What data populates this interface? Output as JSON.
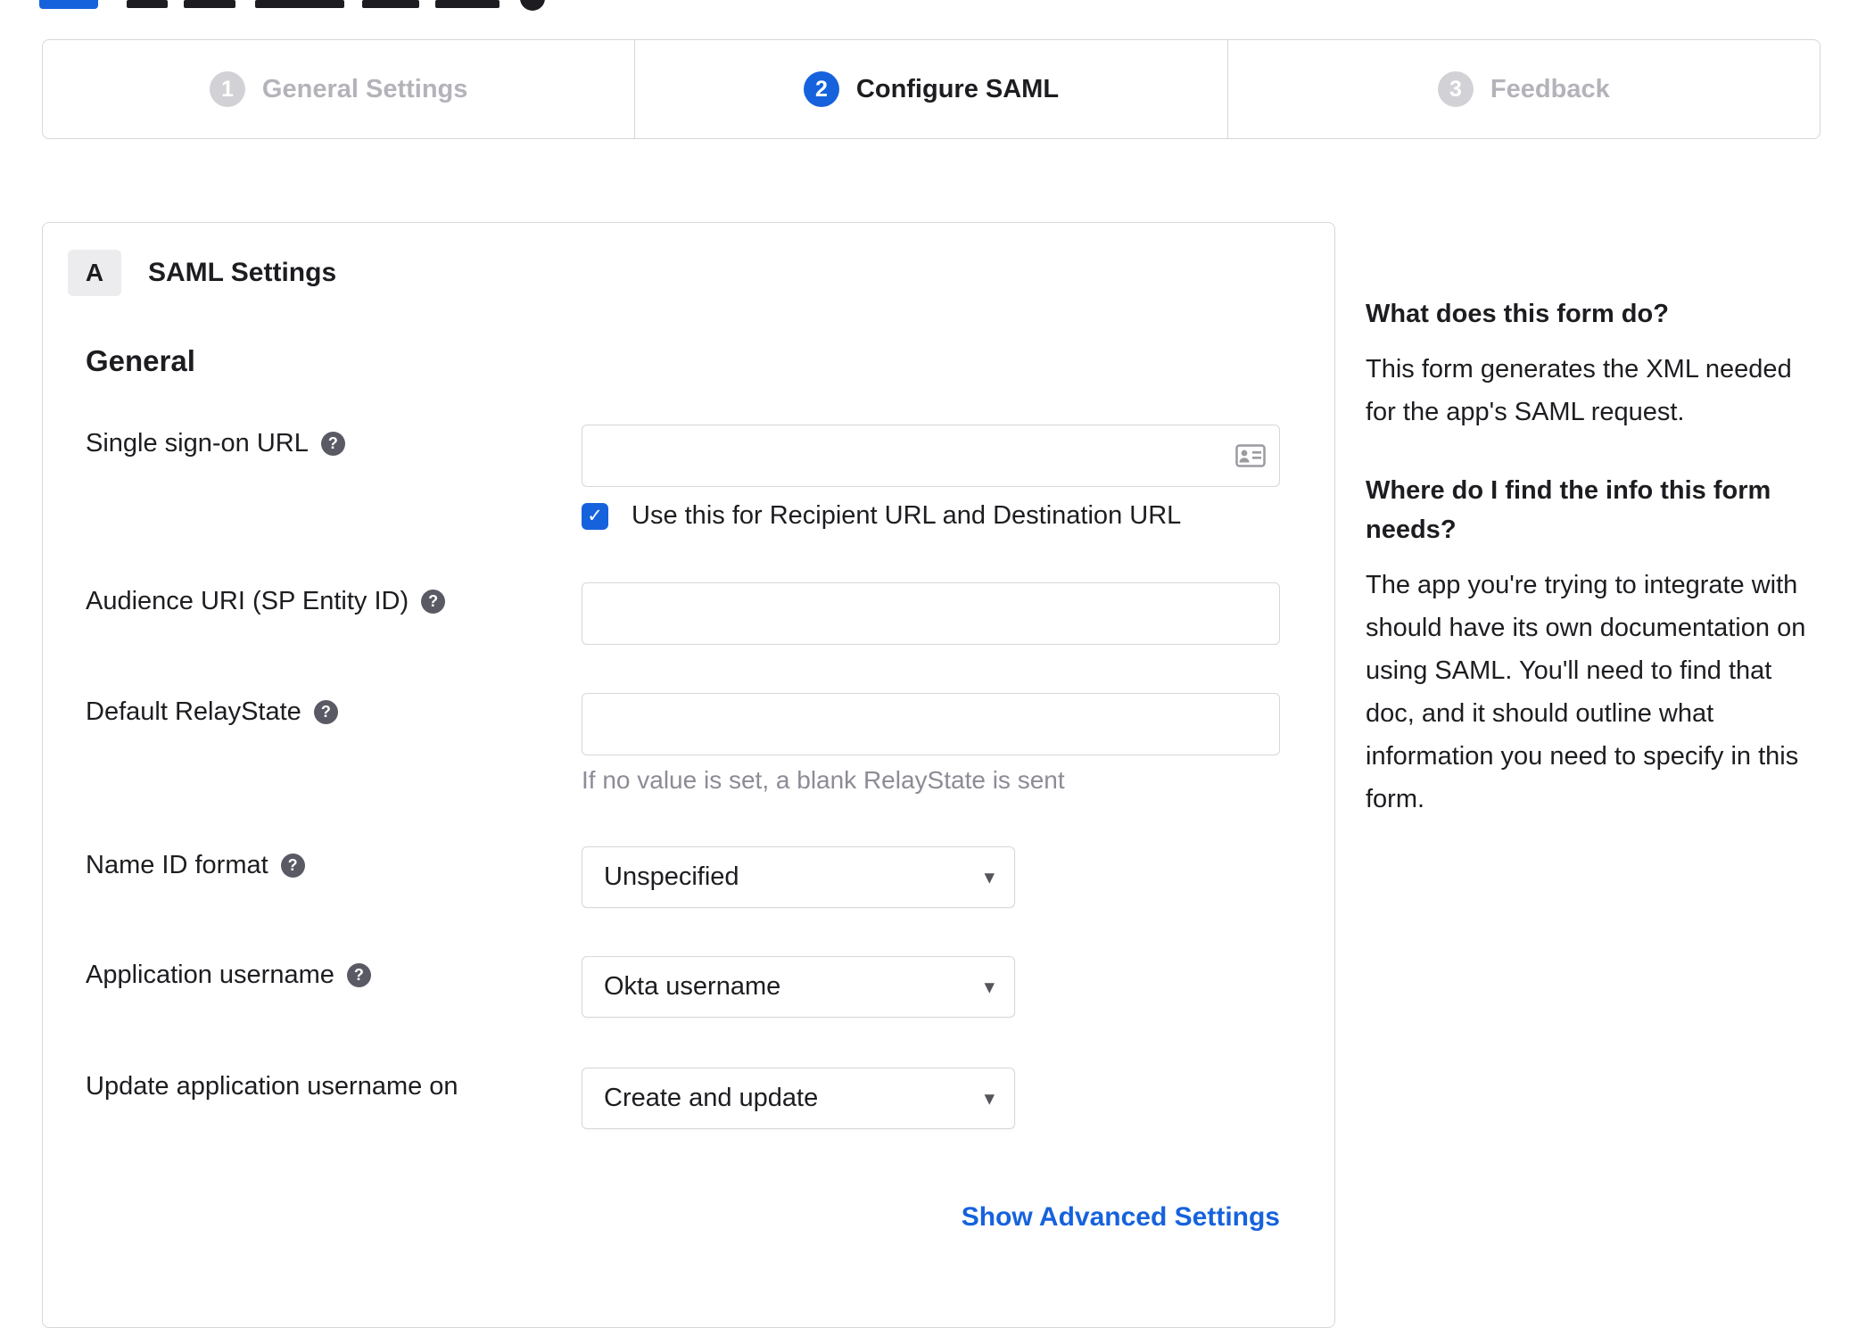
{
  "colors": {
    "accent_blue": "#1662dd",
    "inactive_step_gray": "#d2d2d6",
    "border_gray": "#d7d7dc",
    "text_dark": "#1d1d21",
    "muted_text": "#8c8c96"
  },
  "icons": {
    "help": "?",
    "check": "✓",
    "dropdown_arrow": "▾"
  },
  "stepper": {
    "steps": [
      {
        "number": "1",
        "label": "General Settings"
      },
      {
        "number": "2",
        "label": "Configure SAML"
      },
      {
        "number": "3",
        "label": "Feedback"
      }
    ]
  },
  "panel": {
    "badge": "A",
    "title": "SAML Settings",
    "general_heading": "General",
    "fields": {
      "sso_url": {
        "label": "Single sign-on URL",
        "value": "",
        "checkbox_label": "Use this for Recipient URL and Destination URL"
      },
      "audience_uri": {
        "label": "Audience URI (SP Entity ID)",
        "value": ""
      },
      "default_relaystate": {
        "label": "Default RelayState",
        "value": "",
        "hint": "If no value is set, a blank RelayState is sent"
      },
      "name_id_format": {
        "label": "Name ID format",
        "value": "Unspecified"
      },
      "application_username": {
        "label": "Application username",
        "value": "Okta username"
      },
      "update_application_username": {
        "label": "Update application username on",
        "value": "Create and update"
      }
    },
    "show_advanced_label": "Show Advanced Settings"
  },
  "sidebar": {
    "sections": [
      {
        "heading": "What does this form do?",
        "body": "This form generates the XML needed for the app's SAML request."
      },
      {
        "heading": "Where do I find the info this form needs?",
        "body": "The app you're trying to integrate with should have its own documentation on using SAML. You'll need to find that doc, and it should outline what information you need to specify in this form."
      }
    ]
  }
}
